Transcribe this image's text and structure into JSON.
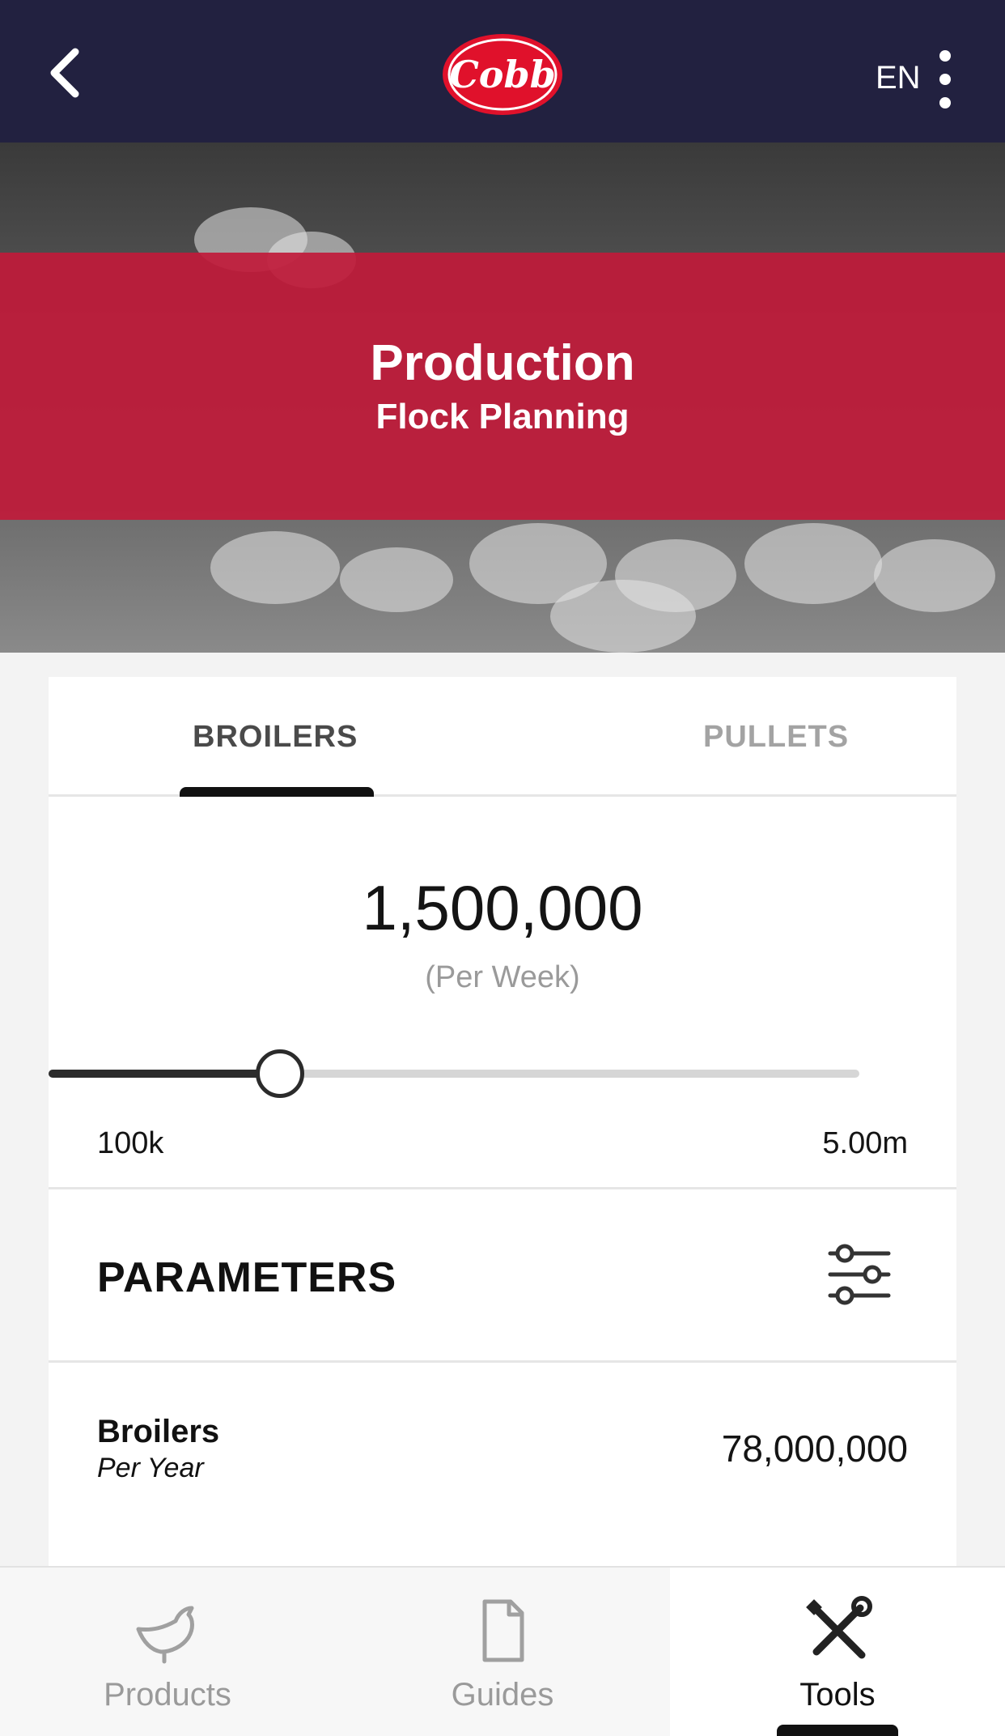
{
  "header": {
    "brand": "Cobb",
    "language": "EN",
    "back_icon": "chevron-left-icon",
    "more_icon": "more-vertical-icon",
    "background_color": "#222140"
  },
  "hero": {
    "title": "Production",
    "subtitle": "Flock Planning",
    "band_color": "#c01a3a"
  },
  "tabs": [
    {
      "label": "BROILERS",
      "active": true
    },
    {
      "label": "PULLETS",
      "active": false
    }
  ],
  "quantity": {
    "value": "1,500,000",
    "unit": "(Per Week)"
  },
  "slider": {
    "min_label": "100k",
    "max_label": "5.00m",
    "min": 100000,
    "max": 5000000,
    "value": 1500000
  },
  "parameters": {
    "title": "PARAMETERS",
    "icon": "sliders-icon"
  },
  "results": [
    {
      "label": "Broilers",
      "sublabel": "Per Year",
      "value": "78,000,000"
    }
  ],
  "bottom_nav": [
    {
      "label": "Products",
      "icon": "bird-icon",
      "active": false
    },
    {
      "label": "Guides",
      "icon": "document-icon",
      "active": false
    },
    {
      "label": "Tools",
      "icon": "tools-icon",
      "active": true
    }
  ]
}
